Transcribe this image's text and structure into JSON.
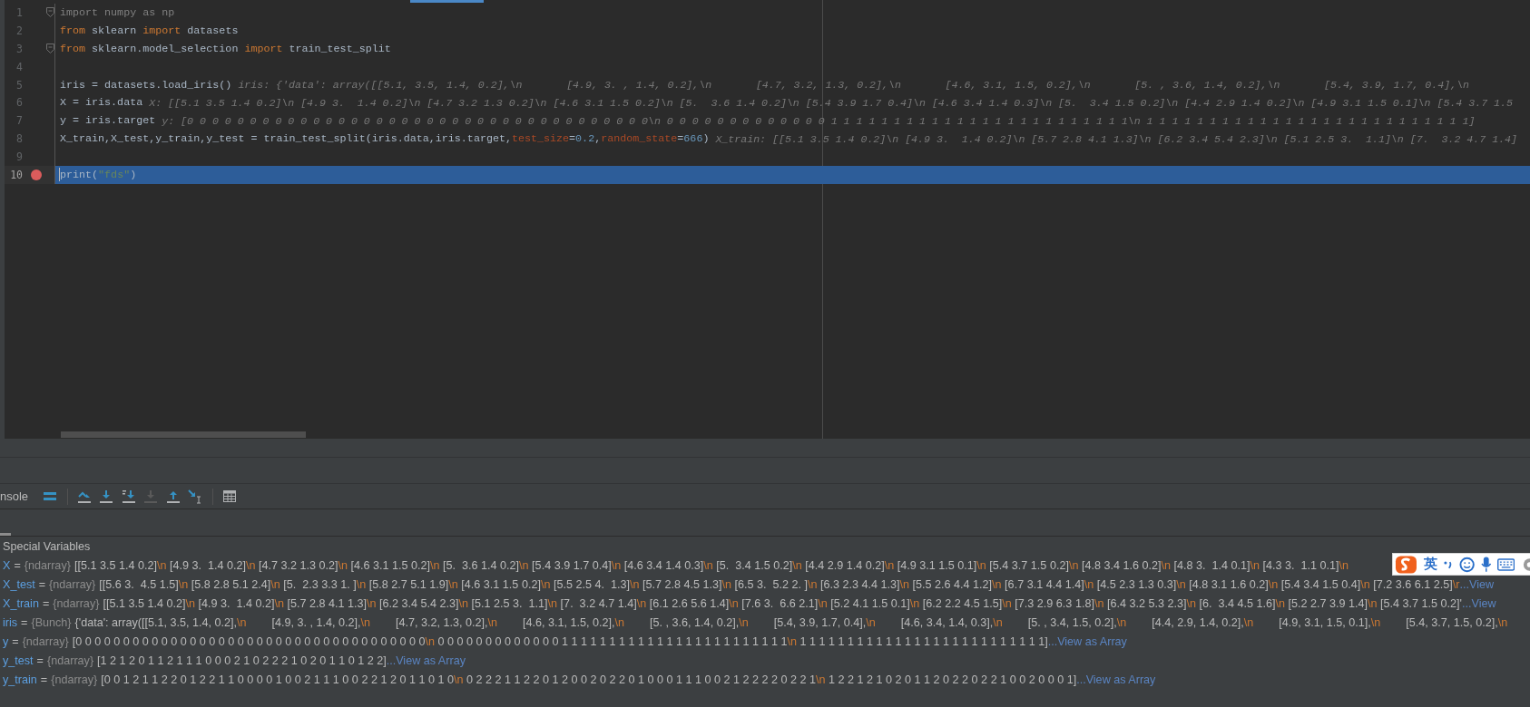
{
  "editor": {
    "lines": [
      {
        "number": "1",
        "fold": true,
        "breakpoint": false,
        "current": false,
        "tokens": [
          {
            "kind": "unused",
            "text": "import numpy as np"
          }
        ]
      },
      {
        "number": "2",
        "fold": false,
        "breakpoint": false,
        "current": false,
        "tokens": [
          {
            "kind": "kw",
            "text": "from"
          },
          {
            "kind": "plain",
            "text": " sklearn "
          },
          {
            "kind": "kw",
            "text": "import"
          },
          {
            "kind": "plain",
            "text": " datasets"
          }
        ]
      },
      {
        "number": "3",
        "fold": true,
        "breakpoint": false,
        "current": false,
        "tokens": [
          {
            "kind": "kw",
            "text": "from"
          },
          {
            "kind": "plain",
            "text": " sklearn.model_selection "
          },
          {
            "kind": "kw",
            "text": "import"
          },
          {
            "kind": "plain",
            "text": " train_test_split"
          }
        ]
      },
      {
        "number": "4",
        "fold": false,
        "breakpoint": false,
        "current": false
      },
      {
        "number": "5",
        "fold": false,
        "breakpoint": false,
        "current": false,
        "tokens": [
          {
            "kind": "plain",
            "text": "iris = datasets.load_iris()"
          },
          {
            "kind": "hint",
            "text": "iris: {'data': array([[5.1, 3.5, 1.4, 0.2],\\n       [4.9, 3. , 1.4, 0.2],\\n       [4.7, 3.2, 1.3, 0.2],\\n       [4.6, 3.1, 1.5, 0.2],\\n       [5. , 3.6, 1.4, 0.2],\\n       [5.4, 3.9, 1.7, 0.4],\\n"
          }
        ]
      },
      {
        "number": "6",
        "fold": false,
        "breakpoint": false,
        "current": false,
        "tokens": [
          {
            "kind": "plain",
            "text": "X = iris.data"
          },
          {
            "kind": "hint",
            "text": "X: [[5.1 3.5 1.4 0.2]\\n [4.9 3.  1.4 0.2]\\n [4.7 3.2 1.3 0.2]\\n [4.6 3.1 1.5 0.2]\\n [5.  3.6 1.4 0.2]\\n [5.4 3.9 1.7 0.4]\\n [4.6 3.4 1.4 0.3]\\n [5.  3.4 1.5 0.2]\\n [4.4 2.9 1.4 0.2]\\n [4.9 3.1 1.5 0.1]\\n [5.4 3.7 1.5"
          }
        ]
      },
      {
        "number": "7",
        "fold": false,
        "breakpoint": false,
        "current": false,
        "tokens": [
          {
            "kind": "plain",
            "text": "y = iris.target"
          },
          {
            "kind": "hint",
            "text": "y: [0 0 0 0 0 0 0 0 0 0 0 0 0 0 0 0 0 0 0 0 0 0 0 0 0 0 0 0 0 0 0 0 0 0 0 0 0\\n 0 0 0 0 0 0 0 0 0 0 0 0 0 1 1 1 1 1 1 1 1 1 1 1 1 1 1 1 1 1 1 1 1 1 1 1 1\\n 1 1 1 1 1 1 1 1 1 1 1 1 1 1 1 1 1 1 1 1 1 1 1 1 1 1]"
          }
        ]
      },
      {
        "number": "8",
        "fold": false,
        "breakpoint": false,
        "current": false,
        "tokens": [
          {
            "kind": "plain",
            "text": "X_train,X_test,y_train,y_test = train_test_split(iris.data,iris.target,"
          },
          {
            "kind": "param",
            "text": "test_size"
          },
          {
            "kind": "plain",
            "text": "="
          },
          {
            "kind": "num",
            "text": "0.2"
          },
          {
            "kind": "plain",
            "text": ","
          },
          {
            "kind": "param",
            "text": "random_state"
          },
          {
            "kind": "plain",
            "text": "="
          },
          {
            "kind": "num",
            "text": "666"
          },
          {
            "kind": "plain",
            "text": ")"
          },
          {
            "kind": "hint",
            "text": "X_train: [[5.1 3.5 1.4 0.2]\\n [4.9 3.  1.4 0.2]\\n [5.7 2.8 4.1 1.3]\\n [6.2 3.4 5.4 2.3]\\n [5.1 2.5 3.  1.1]\\n [7.  3.2 4.7 1.4]"
          }
        ]
      },
      {
        "number": "9",
        "fold": false,
        "breakpoint": false,
        "current": false
      },
      {
        "number": "10",
        "fold": false,
        "breakpoint": true,
        "current": true,
        "tokens": [
          {
            "kind": "plain",
            "text": "print("
          },
          {
            "kind": "str",
            "text": "\"fds\""
          },
          {
            "kind": "plain",
            "text": ")"
          }
        ]
      }
    ]
  },
  "debug_panel": {
    "tab_label": "nsole",
    "tools": [
      {
        "kind": "menu",
        "disabled": false
      },
      {
        "kind": "step_over",
        "disabled": false
      },
      {
        "kind": "step_into",
        "disabled": false
      },
      {
        "kind": "step_into_mine",
        "disabled": false
      },
      {
        "kind": "force_step",
        "disabled": true
      },
      {
        "kind": "step_out",
        "disabled": false
      },
      {
        "kind": "run_to_cursor",
        "disabled": false
      },
      {
        "kind": "table",
        "disabled": false
      }
    ],
    "section_title": "Special Variables",
    "variables": [
      {
        "name": "X",
        "equals": "=",
        "type": "{ndarray}",
        "value": [
          {
            "kind": "text",
            "text": "[[5.1 3.5 1.4 0.2]"
          },
          {
            "kind": "esc",
            "text": "\\n"
          },
          {
            "kind": "text",
            "text": " [4.9 3.  1.4 0.2]"
          },
          {
            "kind": "esc",
            "text": "\\n"
          },
          {
            "kind": "text",
            "text": " [4.7 3.2 1.3 0.2]"
          },
          {
            "kind": "esc",
            "text": "\\n"
          },
          {
            "kind": "text",
            "text": " [4.6 3.1 1.5 0.2]"
          },
          {
            "kind": "esc",
            "text": "\\n"
          },
          {
            "kind": "text",
            "text": " [5.  3.6 1.4 0.2]"
          },
          {
            "kind": "esc",
            "text": "\\n"
          },
          {
            "kind": "text",
            "text": " [5.4 3.9 1.7 0.4]"
          },
          {
            "kind": "esc",
            "text": "\\n"
          },
          {
            "kind": "text",
            "text": " [4.6 3.4 1.4 0.3]"
          },
          {
            "kind": "esc",
            "text": "\\n"
          },
          {
            "kind": "text",
            "text": " [5.  3.4 1.5 0.2]"
          },
          {
            "kind": "esc",
            "text": "\\n"
          },
          {
            "kind": "text",
            "text": " [4.4 2.9 1.4 0.2]"
          },
          {
            "kind": "esc",
            "text": "\\n"
          },
          {
            "kind": "text",
            "text": " [4.9 3.1 1.5 0.1]"
          },
          {
            "kind": "esc",
            "text": "\\n"
          },
          {
            "kind": "text",
            "text": " [5.4 3.7 1.5 0.2]"
          },
          {
            "kind": "esc",
            "text": "\\n"
          },
          {
            "kind": "text",
            "text": " [4.8 3.4 1.6 0.2]"
          },
          {
            "kind": "esc",
            "text": "\\n"
          },
          {
            "kind": "text",
            "text": " [4.8 3.  1.4 0.1]"
          },
          {
            "kind": "esc",
            "text": "\\n"
          },
          {
            "kind": "text",
            "text": " [4.3 3.  1.1 0.1]"
          },
          {
            "kind": "esc",
            "text": "\\n"
          }
        ]
      },
      {
        "name": "X_test",
        "equals": "=",
        "type": "{ndarray}",
        "value": [
          {
            "kind": "text",
            "text": "[[5.6 3.  4.5 1.5]"
          },
          {
            "kind": "esc",
            "text": "\\n"
          },
          {
            "kind": "text",
            "text": " [5.8 2.8 5.1 2.4]"
          },
          {
            "kind": "esc",
            "text": "\\n"
          },
          {
            "kind": "text",
            "text": " [5.  2.3 3.3 1. ]"
          },
          {
            "kind": "esc",
            "text": "\\n"
          },
          {
            "kind": "text",
            "text": " [5.8 2.7 5.1 1.9]"
          },
          {
            "kind": "esc",
            "text": "\\n"
          },
          {
            "kind": "text",
            "text": " [4.6 3.1 1.5 0.2]"
          },
          {
            "kind": "esc",
            "text": "\\n"
          },
          {
            "kind": "text",
            "text": " [5.5 2.5 4.  1.3]"
          },
          {
            "kind": "esc",
            "text": "\\n"
          },
          {
            "kind": "text",
            "text": " [5.7 2.8 4.5 1.3]"
          },
          {
            "kind": "esc",
            "text": "\\n"
          },
          {
            "kind": "text",
            "text": " [6.5 3.  5.2 2. ]"
          },
          {
            "kind": "esc",
            "text": "\\n"
          },
          {
            "kind": "text",
            "text": " [6.3 2.3 4.4 1.3]"
          },
          {
            "kind": "esc",
            "text": "\\n"
          },
          {
            "kind": "text",
            "text": " [5.5 2.6 4.4 1.2]"
          },
          {
            "kind": "esc",
            "text": "\\n"
          },
          {
            "kind": "text",
            "text": " [6.7 3.1 4.4 1.4]"
          },
          {
            "kind": "esc",
            "text": "\\n"
          },
          {
            "kind": "text",
            "text": " [4.5 2.3 1.3 0.3]"
          },
          {
            "kind": "esc",
            "text": "\\n"
          },
          {
            "kind": "text",
            "text": " [4.8 3.1 1.6 0.2]"
          },
          {
            "kind": "esc",
            "text": "\\n"
          },
          {
            "kind": "text",
            "text": " [5.4 3.4 1.5 0.4]"
          },
          {
            "kind": "esc",
            "text": "\\n"
          },
          {
            "kind": "text",
            "text": " [7.2 3.6 6.1 2.5]"
          },
          {
            "kind": "esc",
            "text": "\\r"
          }
        ],
        "link": "...View"
      },
      {
        "name": "X_train",
        "equals": "=",
        "type": "{ndarray}",
        "value": [
          {
            "kind": "text",
            "text": "[[5.1 3.5 1.4 0.2]"
          },
          {
            "kind": "esc",
            "text": "\\n"
          },
          {
            "kind": "text",
            "text": " [4.9 3.  1.4 0.2]"
          },
          {
            "kind": "esc",
            "text": "\\n"
          },
          {
            "kind": "text",
            "text": " [5.7 2.8 4.1 1.3]"
          },
          {
            "kind": "esc",
            "text": "\\n"
          },
          {
            "kind": "text",
            "text": " [6.2 3.4 5.4 2.3]"
          },
          {
            "kind": "esc",
            "text": "\\n"
          },
          {
            "kind": "text",
            "text": " [5.1 2.5 3.  1.1]"
          },
          {
            "kind": "esc",
            "text": "\\n"
          },
          {
            "kind": "text",
            "text": " [7.  3.2 4.7 1.4]"
          },
          {
            "kind": "esc",
            "text": "\\n"
          },
          {
            "kind": "text",
            "text": " [6.1 2.6 5.6 1.4]"
          },
          {
            "kind": "esc",
            "text": "\\n"
          },
          {
            "kind": "text",
            "text": " [7.6 3.  6.6 2.1]"
          },
          {
            "kind": "esc",
            "text": "\\n"
          },
          {
            "kind": "text",
            "text": " [5.2 4.1 1.5 0.1]"
          },
          {
            "kind": "esc",
            "text": "\\n"
          },
          {
            "kind": "text",
            "text": " [6.2 2.2 4.5 1.5]"
          },
          {
            "kind": "esc",
            "text": "\\n"
          },
          {
            "kind": "text",
            "text": " [7.3 2.9 6.3 1.8]"
          },
          {
            "kind": "esc",
            "text": "\\n"
          },
          {
            "kind": "text",
            "text": " [6.4 3.2 5.3 2.3]"
          },
          {
            "kind": "esc",
            "text": "\\n"
          },
          {
            "kind": "text",
            "text": " [6.  3.4 4.5 1.6]"
          },
          {
            "kind": "esc",
            "text": "\\n"
          },
          {
            "kind": "text",
            "text": " [5.2 2.7 3.9 1.4]"
          },
          {
            "kind": "esc",
            "text": "\\n"
          },
          {
            "kind": "text",
            "text": " [5.4 3.7 1.5 0.2]'"
          }
        ],
        "link": "...View"
      },
      {
        "name": "iris",
        "equals": "=",
        "type": "{Bunch}",
        "value": [
          {
            "kind": "text",
            "text": "{'data': array([[5.1, 3.5, 1.4, 0.2],"
          },
          {
            "kind": "esc",
            "text": "\\n"
          },
          {
            "kind": "text",
            "text": "        [4.9, 3. , 1.4, 0.2],"
          },
          {
            "kind": "esc",
            "text": "\\n"
          },
          {
            "kind": "text",
            "text": "        [4.7, 3.2, 1.3, 0.2],"
          },
          {
            "kind": "esc",
            "text": "\\n"
          },
          {
            "kind": "text",
            "text": "        [4.6, 3.1, 1.5, 0.2],"
          },
          {
            "kind": "esc",
            "text": "\\n"
          },
          {
            "kind": "text",
            "text": "        [5. , 3.6, 1.4, 0.2],"
          },
          {
            "kind": "esc",
            "text": "\\n"
          },
          {
            "kind": "text",
            "text": "        [5.4, 3.9, 1.7, 0.4],"
          },
          {
            "kind": "esc",
            "text": "\\n"
          },
          {
            "kind": "text",
            "text": "        [4.6, 3.4, 1.4, 0.3],"
          },
          {
            "kind": "esc",
            "text": "\\n"
          },
          {
            "kind": "text",
            "text": "        [5. , 3.4, 1.5, 0.2],"
          },
          {
            "kind": "esc",
            "text": "\\n"
          },
          {
            "kind": "text",
            "text": "        [4.4, 2.9, 1.4, 0.2],"
          },
          {
            "kind": "esc",
            "text": "\\n"
          },
          {
            "kind": "text",
            "text": "        [4.9, 3.1, 1.5, 0.1],"
          },
          {
            "kind": "esc",
            "text": "\\n"
          },
          {
            "kind": "text",
            "text": "        [5.4, 3.7, 1.5, 0.2],"
          },
          {
            "kind": "esc",
            "text": "\\n"
          }
        ]
      },
      {
        "name": "y",
        "equals": "=",
        "type": "{ndarray}",
        "value": [
          {
            "kind": "text",
            "text": "[0 0 0 0 0 0 0 0 0 0 0 0 0 0 0 0 0 0 0 0 0 0 0 0 0 0 0 0 0 0 0 0 0 0 0 0 0"
          },
          {
            "kind": "esc",
            "text": "\\n"
          },
          {
            "kind": "text",
            "text": " 0 0 0 0 0 0 0 0 0 0 0 0 0 1 1 1 1 1 1 1 1 1 1 1 1 1 1 1 1 1 1 1 1 1 1 1 1"
          },
          {
            "kind": "esc",
            "text": "\\n"
          },
          {
            "kind": "text",
            "text": " 1 1 1 1 1 1 1 1 1 1 1 1 1 1 1 1 1 1 1 1 1 1 1 1 1 1]"
          }
        ],
        "link": "...View as Array"
      },
      {
        "name": "y_test",
        "equals": "=",
        "type": "{ndarray}",
        "value": [
          {
            "kind": "text",
            "text": "[1 2 1 2 0 1 1 2 1 1 1 0 0 0 2 1 0 2 2 2 1 0 2 0 1 1 0 1 2 2]"
          }
        ],
        "link": "...View as Array"
      },
      {
        "name": "y_train",
        "equals": "=",
        "type": "{ndarray}",
        "value": [
          {
            "kind": "text",
            "text": "[0 0 1 2 1 1 2 2 0 1 2 2 1 1 0 0 0 0 1 0 0 2 1 1 1 0 0 2 2 1 2 0 1 1 0 1 0"
          },
          {
            "kind": "esc",
            "text": "\\n"
          },
          {
            "kind": "text",
            "text": " 0 2 2 2 1 1 2 2 0 1 2 0 0 2 0 2 2 0 1 0 0 0 1 1 1 0 0 2 1 2 2 2 2 0 2 2 1"
          },
          {
            "kind": "esc",
            "text": "\\n"
          },
          {
            "kind": "text",
            "text": " 1 2 2 1 2 1 0 2 0 1 1 2 0 2 2 0 2 2 1 0 0 2 0 0 0 1]"
          }
        ],
        "link": "...View as Array"
      }
    ]
  },
  "ime_bar": {
    "mode_label": "英"
  }
}
